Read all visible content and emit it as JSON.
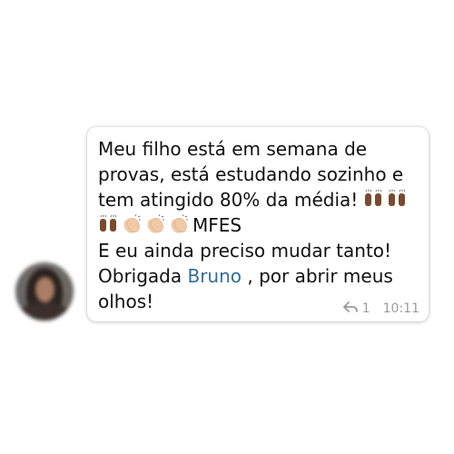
{
  "message": {
    "line1": "Meu filho está em semana de",
    "line2": "provas, está estudando sozinho e",
    "line3_text": "tem atingido 80% da média!",
    "line4_text": "MFES",
    "line5": "E eu ainda preciso mudar tanto!",
    "line6_before": "Obrigada",
    "mention": "Bruno",
    "line6_after": ", por abrir meus",
    "line7": "olhos!"
  },
  "emoji": {
    "line3": [
      "raising-hands",
      "raising-hands"
    ],
    "line4": [
      "raising-hands",
      "clapping-hands",
      "clapping-hands",
      "clapping-hands"
    ]
  },
  "meta": {
    "reply_icon": "reply-icon",
    "reply_count": "1",
    "time": "10:11"
  },
  "colors": {
    "mention": "#2f6e9c",
    "meta_text": "#9b9b9b",
    "raising_hands": "#7a4a2e",
    "clapping_hands": "#f1c9a5"
  }
}
